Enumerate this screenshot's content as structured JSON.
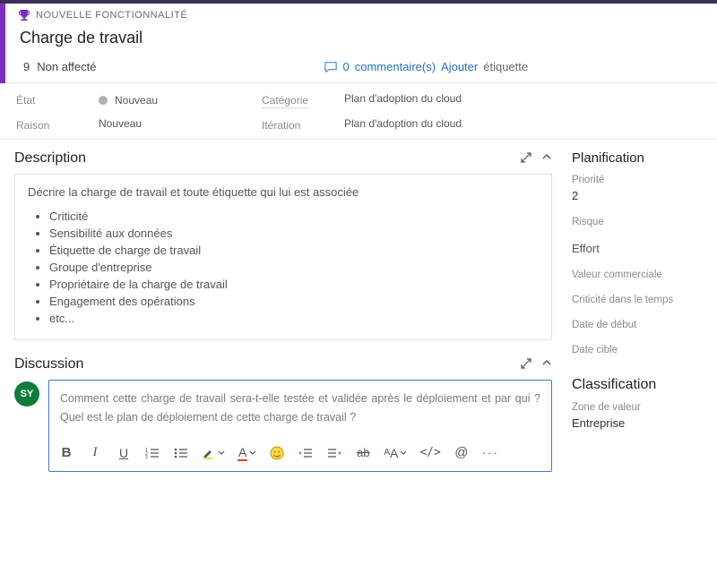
{
  "header": {
    "type_label": "NOUVELLE FONCTIONNALITÉ",
    "title": "Charge de travail",
    "assignee": "Non affecté",
    "assignee_icon_num": "9",
    "comments_count": "0",
    "comments_word": "commentaire(s)",
    "add_label": "Ajouter",
    "tag_label": "étiquette"
  },
  "fields": {
    "state_label": "État",
    "state_value": "Nouveau",
    "reason_label": "Raison",
    "reason_value": "Nouveau",
    "category_label": "Catégorie",
    "category_value": "Plan d'adoption du cloud",
    "iteration_label": "Itération",
    "iteration_value": "Plan d'adoption du cloud"
  },
  "description": {
    "title": "Description",
    "intro": "Décrire la charge de travail et toute étiquette qui lui est associée",
    "items": [
      "Criticité",
      "Sensibilité aux données",
      "Étiquette de charge de travail",
      "Groupe d'entreprise",
      "Propriétaire de la charge de travail",
      "Engagement des opérations",
      "etc..."
    ]
  },
  "discussion": {
    "title": "Discussion",
    "avatar_initials": "SY",
    "text": "Comment cette charge de travail sera-t-elle testée et validée après le déploiement et par qui ? Quel est le plan de déploiement de cette charge de travail ?"
  },
  "side": {
    "planning_title": "Planification",
    "priority_label": "Priorité",
    "priority_value": "2",
    "risk_label": "Risque",
    "effort_label": "Effort",
    "business_value_label": "Valeur commerciale",
    "time_crit_label": "Criticité dans le temps",
    "start_date_label": "Date de début",
    "target_date_label": "Date cible",
    "classification_title": "Classification",
    "value_area_label": "Zone de valeur",
    "value_area_value": "Entreprise"
  }
}
